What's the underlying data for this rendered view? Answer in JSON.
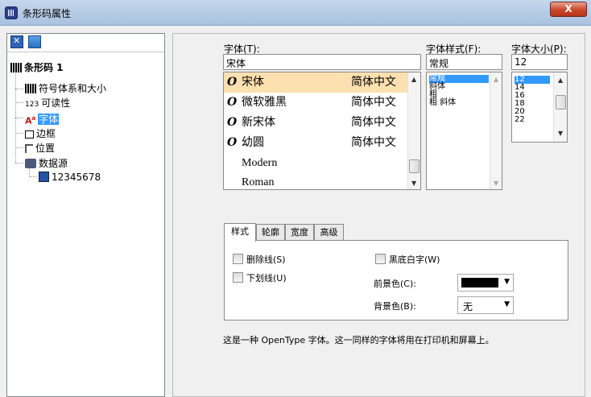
{
  "window": {
    "title": "条形码属性",
    "close_label": "X"
  },
  "tree": {
    "root": "条形码 1",
    "items": [
      "符号体系和大小",
      "可读性",
      "字体",
      "边框",
      "位置",
      "数据源"
    ],
    "readability_prefix": "123",
    "data_value": "12345678",
    "selected": "字体"
  },
  "font_panel": {
    "font_label": "字体(T):",
    "font_value": "宋体",
    "style_label": "字体样式(F):",
    "style_value": "常规",
    "size_label": "字体大小(P):",
    "size_value": "12",
    "fonts": [
      {
        "name": "宋体",
        "script": "简体中文",
        "selected": true
      },
      {
        "name": "微软雅黑",
        "script": "简体中文"
      },
      {
        "name": "新宋体",
        "script": "简体中文"
      },
      {
        "name": "幼圆",
        "script": "简体中文"
      },
      {
        "name": "Modern",
        "script": ""
      },
      {
        "name": "Roman",
        "script": ""
      }
    ],
    "styles": [
      "常规",
      "斜体",
      "粗",
      "粗 斜体"
    ],
    "sizes": [
      "12",
      "14",
      "16",
      "18",
      "20",
      "22"
    ]
  },
  "tabs": [
    "样式",
    "轮廓",
    "宽度",
    "高级"
  ],
  "style_tab": {
    "strikeout": "删除线(S)",
    "underline": "下划线(U)",
    "inverse": "黑底白字(W)",
    "foreground_label": "前景色(C):",
    "background_label": "背景色(B):",
    "background_value": "无",
    "foreground_color": "#000000"
  },
  "note": "这是一种 OpenType 字体。这一同样的字体将用在打印机和屏幕上。"
}
